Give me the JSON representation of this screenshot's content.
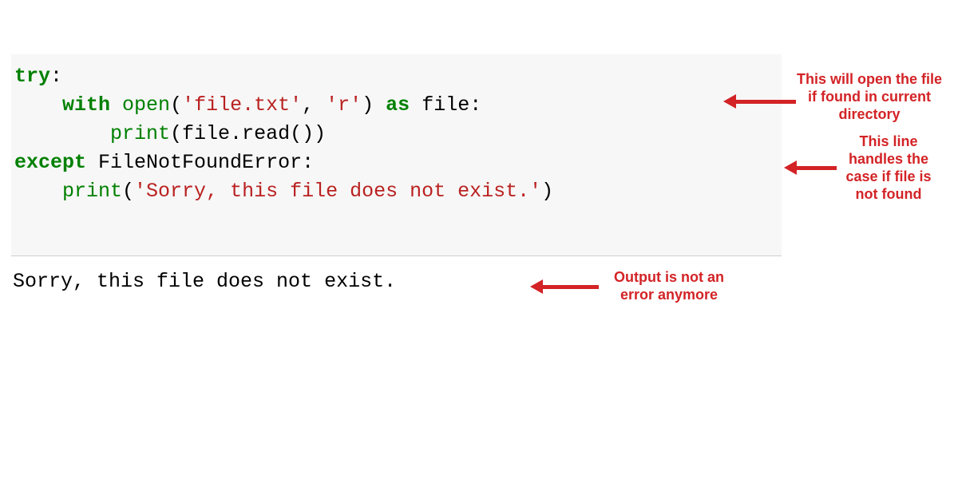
{
  "code": {
    "line1_try": "try",
    "line1_colon": ":",
    "line2_indent": "    ",
    "line2_with": "with",
    "line2_sp1": " ",
    "line2_open": "open",
    "line2_paren_open": "(",
    "line2_str_file": "'file.txt'",
    "line2_comma": ", ",
    "line2_str_mode": "'r'",
    "line2_paren_close": ")",
    "line2_sp2": " ",
    "line2_as": "as",
    "line2_sp3": " ",
    "line2_ident": "file:",
    "line3_indent": "        ",
    "line3_print": "print",
    "line3_rest": "(file.read())",
    "line4_except": "except",
    "line4_sp": " ",
    "line4_type": "FileNotFoundError:",
    "line5_indent": "    ",
    "line5_print": "print",
    "line5_paren": "(",
    "line5_str": "'Sorry, this file does not exist.'",
    "line5_close": ")"
  },
  "output": "Sorry, this file does not exist.",
  "annotations": {
    "a1": "This will open the file if found in current directory",
    "a2": "This line handles the case if file is not found",
    "a3": "Output is not an error anymore"
  }
}
